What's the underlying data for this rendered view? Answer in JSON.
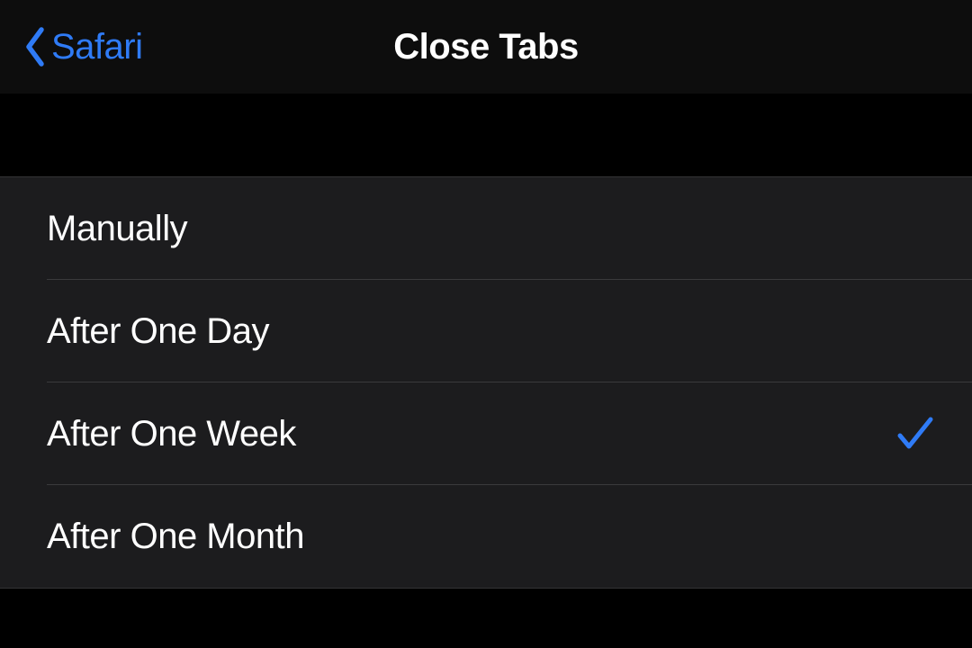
{
  "nav": {
    "back_label": "Safari",
    "title": "Close Tabs"
  },
  "options": [
    {
      "label": "Manually",
      "selected": false
    },
    {
      "label": "After One Day",
      "selected": false
    },
    {
      "label": "After One Week",
      "selected": true
    },
    {
      "label": "After One Month",
      "selected": false
    }
  ],
  "colors": {
    "accent": "#2f7bf6",
    "background": "#000000",
    "list_background": "#1c1c1e",
    "text": "#ffffff"
  }
}
